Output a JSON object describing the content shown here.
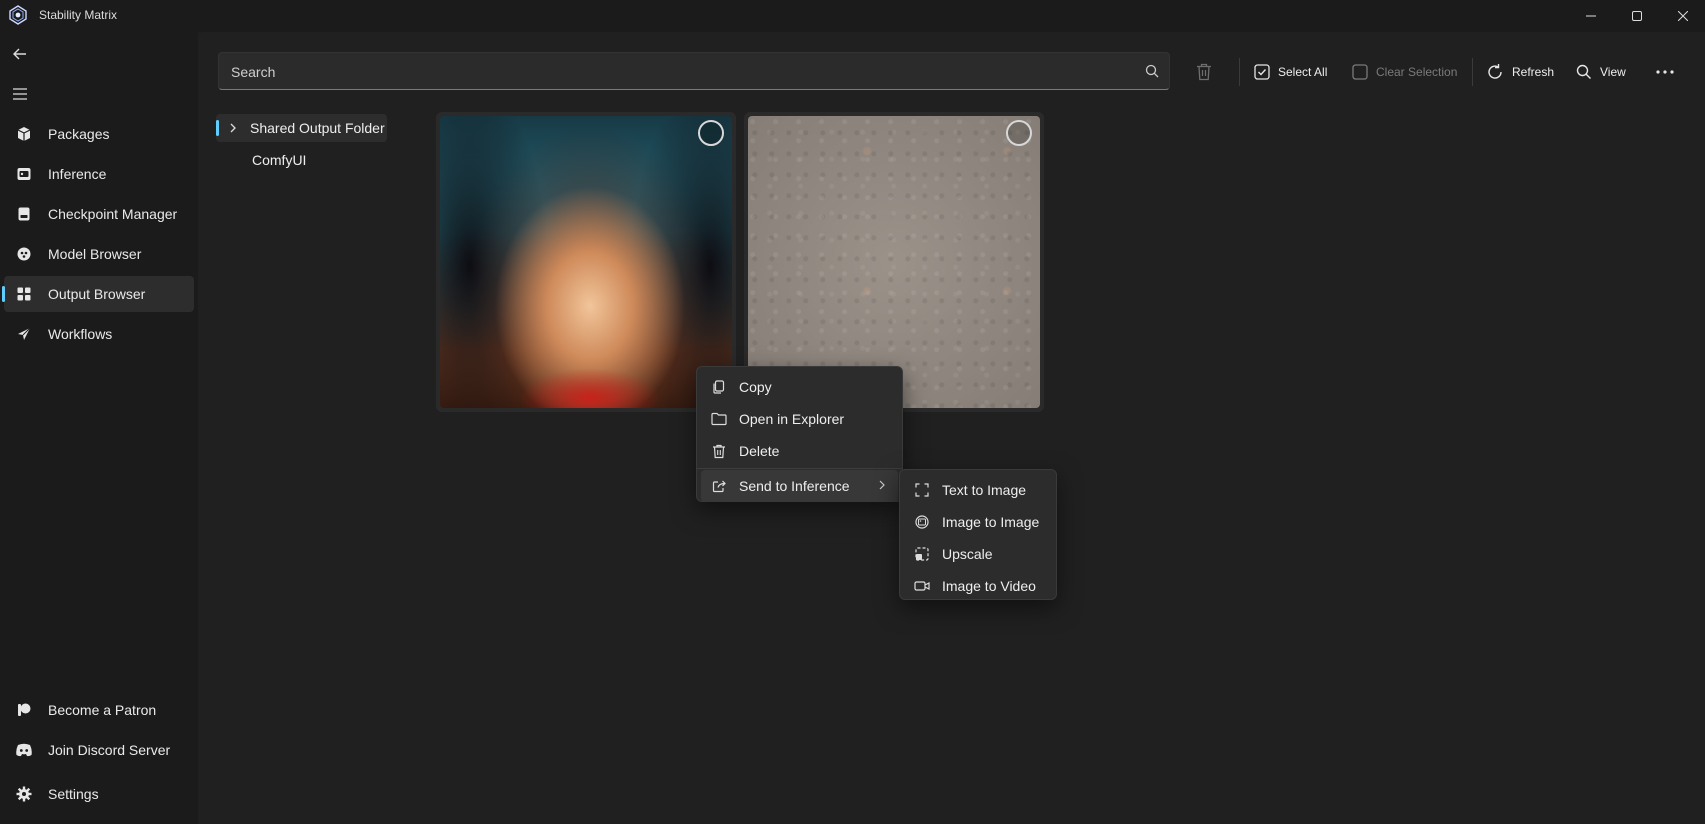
{
  "app": {
    "title": "Stability Matrix"
  },
  "sidebar": {
    "items": [
      {
        "label": "Packages",
        "icon": "package-icon"
      },
      {
        "label": "Inference",
        "icon": "inference-icon"
      },
      {
        "label": "Checkpoint Manager",
        "icon": "checkpoint-icon"
      },
      {
        "label": "Model Browser",
        "icon": "model-browser-icon"
      },
      {
        "label": "Output Browser",
        "icon": "grid-icon",
        "active": true
      },
      {
        "label": "Workflows",
        "icon": "workflow-icon"
      }
    ],
    "footer": [
      {
        "label": "Become a Patron",
        "icon": "patreon-icon"
      },
      {
        "label": "Join Discord Server",
        "icon": "discord-icon"
      },
      {
        "label": "Settings",
        "icon": "gear-icon"
      }
    ]
  },
  "search": {
    "placeholder": "Search",
    "value": ""
  },
  "toolbar": {
    "select_all": "Select All",
    "clear_selection": "Clear Selection",
    "refresh": "Refresh",
    "view": "View"
  },
  "folders": [
    {
      "label": "Shared Output Folder",
      "expanded": false,
      "selected": true
    },
    {
      "label": "ComfyUI"
    }
  ],
  "context_menu": {
    "items": [
      "Copy",
      "Open in Explorer",
      "Delete",
      "Send to Inference"
    ]
  },
  "submenu": {
    "items": [
      "Text to Image",
      "Image to Image",
      "Upscale",
      "Image to Video"
    ]
  },
  "colors": {
    "accent": "#60cdff",
    "background": "#202020",
    "sidebar": "#1b1b1b"
  }
}
